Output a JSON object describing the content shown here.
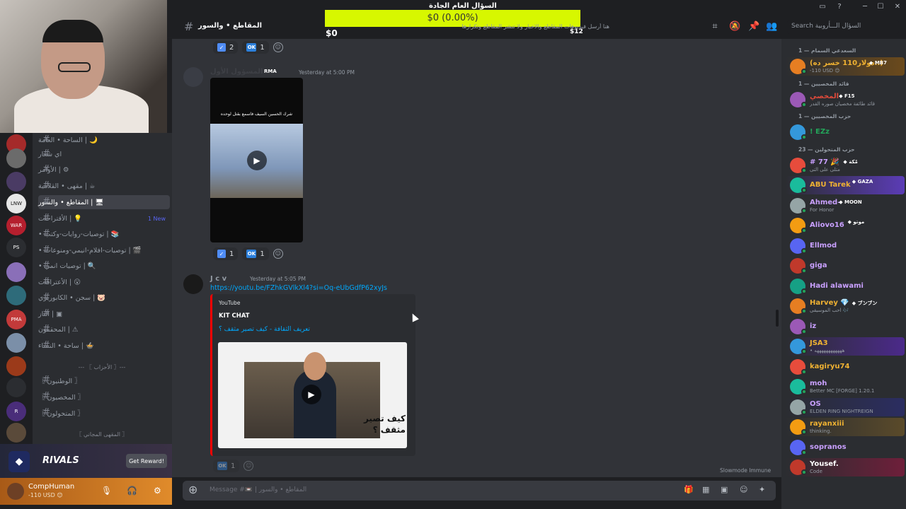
{
  "window": {
    "title": "السؤال العام الجادة"
  },
  "donation": {
    "label": "$0 (0.00%)",
    "left": "$0",
    "right": "$12",
    "progress": 0.0
  },
  "header": {
    "channel": "المقاطع • والسور",
    "topic": "هنا أرسل فيديوهات المقاطع والاخبار ولا تنشر المقاطع وتكرارها",
    "search_placeholder": "Search السؤال الـــأروبية"
  },
  "webcam": {
    "label": "webcam overlay"
  },
  "channels": [
    {
      "name": "الساحة • العامة",
      "icon": "🌙"
    },
    {
      "name": "اي شعار",
      "icon": ""
    },
    {
      "name": "الأوامر",
      "icon": "⚙"
    },
    {
      "name": "مقهى • القلامية",
      "icon": "☕"
    },
    {
      "name": "المقاطع • والسور",
      "icon": "🖥",
      "active": true
    },
    {
      "name": "الأقتراحات",
      "icon": "💡",
      "badge": "1 New"
    },
    {
      "name": "توصيات-روايات-وكتب •",
      "icon": "📚"
    },
    {
      "name": "توصيات-افلام-انيمي-ومنوعات •",
      "icon": "🎬"
    },
    {
      "name": "توصيات انمي •",
      "icon": "🔍"
    },
    {
      "name": "الأعترافات",
      "icon": "😮"
    },
    {
      "name": "سجن • الكابوريزي",
      "icon": "🐷"
    },
    {
      "name": "الناز",
      "icon": "▣"
    },
    {
      "name": "المحققون",
      "icon": "⚠"
    },
    {
      "name": "ساحة • النساء",
      "icon": "🍲"
    }
  ],
  "categories": [
    "--- 〖 الأحزاب 〗---",
    "〖 المقهى المجاني 〗"
  ],
  "party_channels": [
    "〖 الوطنيون 〗",
    "〖 المخصيون 〗",
    "〖 المتحولون 〗"
  ],
  "messages": {
    "reactions_top": [
      {
        "emoji": "check",
        "count": "2"
      },
      {
        "emoji": "OK",
        "count": "1"
      }
    ],
    "post1": {
      "user": "المسؤول الأول",
      "tag": "RMA",
      "time": "Yesterday at 5:00 PM",
      "video_caption": "شرك الحسين السيف فاسمع بقتل لوحده"
    },
    "reactions_mid": [
      {
        "emoji": "check",
        "count": "1"
      },
      {
        "emoji": "OK",
        "count": "1"
      }
    ],
    "post2": {
      "user": "J c v",
      "time": "Yesterday at 5:05 PM",
      "link": "https://youtu.be/FZhkGVlkXl4?si=Oq-eUbGdfP62xyJs",
      "embed": {
        "provider": "YouTube",
        "author": "KIT CHAT",
        "title": "تعريف الثقافة - كيف تصير مثقف ؟",
        "thumb_text": "كيف تصير مثقف ؟"
      }
    },
    "reactions_bottom": [
      {
        "emoji": "OK",
        "count": "1"
      }
    ]
  },
  "composer": {
    "placeholder": "Message #📼 | المقاطع • والسور",
    "slowmode": "Slowmode Immune"
  },
  "promo": {
    "brand": "RIVALS",
    "button": "Get Reward!"
  },
  "user": {
    "name": "CompHuman",
    "status": "-110 USD 😊"
  },
  "members": {
    "groups": [
      {
        "label": "السعدعي السمام — 1",
        "items": [
          {
            "name": "(دولار110 خسر ده..)",
            "sub": "-110 USD 😊",
            "badge": "MB7",
            "color": "#f0b232",
            "highlight": "#6b4a1c"
          }
        ]
      },
      {
        "label": "قائد المخصيين — 1",
        "items": [
          {
            "name": "المخصي",
            "sub": "قائد طائفة مخصيان صوره القدر",
            "badge": "F15",
            "color": "#e04a3a",
            "highlight": ""
          }
        ]
      },
      {
        "label": "حزب المخصيين — 1",
        "items": [
          {
            "name": "! EZz",
            "sub": "",
            "badge": "",
            "color": "#23a55a",
            "highlight": ""
          }
        ]
      },
      {
        "label": "حزب المتحولين — 23",
        "items": [
          {
            "name": "# 77 🎉",
            "sub": "متلى على التى",
            "badge": "مُكة",
            "color": "#c9a0ff",
            "highlight": ""
          },
          {
            "name": "ABU Tarek",
            "sub": "",
            "badge": "GAZA",
            "color": "#f0b232",
            "highlight": "#5b3cb6"
          },
          {
            "name": "Ahmed-",
            "sub": "For Honor",
            "badge": "MOON",
            "color": "#c9a0ff",
            "highlight": ""
          },
          {
            "name": "Aliovo16",
            "sub": "",
            "badge": "موتو",
            "color": "#c9a0ff",
            "highlight": ""
          },
          {
            "name": "Ellmod",
            "sub": "",
            "badge": "",
            "color": "#c9a0ff",
            "highlight": ""
          },
          {
            "name": "giga",
            "sub": "",
            "badge": "",
            "color": "#c9a0ff",
            "highlight": ""
          },
          {
            "name": "Hadi alawami",
            "sub": "",
            "badge": "",
            "color": "#c9a0ff",
            "highlight": ""
          },
          {
            "name": "Harvey 💎",
            "sub": "احب الموسيقى 🎶",
            "badge": "ブンブン",
            "color": "#f0b232",
            "highlight": ""
          },
          {
            "name": "iz",
            "sub": "",
            "badge": "",
            "color": "#c9a0ff",
            "highlight": ""
          },
          {
            "name": "JSA3",
            "sub": "• ههههههههههههه",
            "badge": "",
            "color": "#f0b232",
            "highlight": "#4b2a8a"
          },
          {
            "name": "kagiryu74",
            "sub": "",
            "badge": "",
            "color": "#f0b232",
            "highlight": ""
          },
          {
            "name": "moh",
            "sub": "Better MC [FORGE] 1.20.1",
            "badge": "",
            "color": "#c9a0ff",
            "highlight": ""
          },
          {
            "name": "OS",
            "sub": "ELDEN RING NIGHTREIGN",
            "badge": "",
            "color": "#c9a0ff",
            "highlight": "#2b2d61"
          },
          {
            "name": "rayanxiii",
            "sub": "thinking.",
            "badge": "",
            "color": "#f0b232",
            "highlight": "#5a4a2a"
          },
          {
            "name": "sopranos",
            "sub": "",
            "badge": "",
            "color": "#c9a0ff",
            "highlight": ""
          },
          {
            "name": "Yousef.",
            "sub": "Code",
            "badge": "",
            "color": "#fff",
            "highlight": "#6e1f3a"
          }
        ]
      }
    ]
  }
}
